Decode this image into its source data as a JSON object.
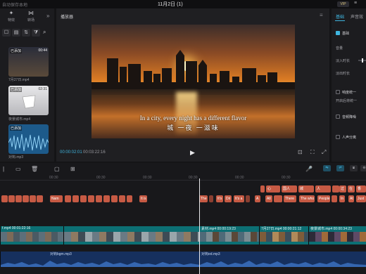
{
  "titlebar": {
    "autosave_hint": "自动保存本地",
    "title": "11月2日 (1)",
    "vip": "VIP",
    "menu": "≡"
  },
  "left_panel": {
    "tabs": [
      {
        "label": "特效",
        "icon": "sparkle-icon"
      },
      {
        "label": "转场",
        "icon": "transition-icon"
      }
    ],
    "more": "»",
    "tools": [
      "☐",
      "▤",
      "⇅",
      "⧩"
    ],
    "search_icon": "⌕",
    "media": [
      {
        "tag": "已添加",
        "duration": "00:44",
        "caption": ""
      },
      {
        "tag": "已添加",
        "duration": "",
        "caption": "7月27日.mp4"
      },
      {
        "tag": "已添加",
        "duration": "02:31",
        "caption": ""
      },
      {
        "tag": "",
        "duration": "",
        "caption": "夜景城市.mp4"
      },
      {
        "tag": "已添加",
        "duration": "",
        "caption": ""
      },
      {
        "tag": "",
        "duration": "",
        "caption": "对钩.mp3"
      }
    ]
  },
  "player": {
    "header": "播放器",
    "menu": "≡",
    "subtitle_en": "In a city, every night has a different flavor",
    "subtitle_zh": "城 一夜 一滋味",
    "current_time": "00:00:02:01",
    "total_time": "00:03:22:16",
    "play_icon": "▶",
    "controls": [
      "⊡",
      "⛶",
      "⤢"
    ]
  },
  "right_panel": {
    "tabs": [
      "基础",
      "声音效"
    ],
    "items": [
      {
        "label": "基础",
        "checked": true
      },
      {
        "label": "音量",
        "checked": null
      },
      {
        "label": "淡入时长",
        "checked": null
      },
      {
        "label": "淡出时长",
        "checked": null
      },
      {
        "label": "响度统一",
        "checked": false
      },
      {
        "label": "开启后将统一",
        "checked": null
      },
      {
        "label": "音频降噪",
        "checked": false
      },
      {
        "label": "人声分离",
        "checked": false
      }
    ],
    "accent": "#3fb6e0"
  },
  "timeline": {
    "tools": [
      "|",
      "▭",
      "🗑",
      "▢",
      "⊞"
    ],
    "right_tools": [
      "🎤",
      "⇆",
      "⇌",
      "⧈",
      "⊖"
    ],
    "ruler": [
      "00:30",
      "00:30",
      "00:30",
      "00:30",
      "00:30",
      "00:30"
    ],
    "text_row1": [
      "",
      "",
      "",
      "",
      "",
      "",
      "",
      "",
      "",
      "",
      "",
      "",
      "",
      "",
      "",
      "",
      "",
      "",
      "",
      "",
      "",
      "",
      "",
      "",
      "",
      "",
      "",
      "",
      "",
      "",
      "",
      "",
      "",
      "",
      "",
      "",
      "",
      "",
      "",
      "",
      "",
      "",
      "",
      "",
      "",
      "",
      "",
      "",
      "",
      "",
      "",
      "",
      "",
      "",
      "",
      "",
      "",
      "",
      "",
      "",
      ""
    ],
    "chips_top": [
      "心",
      "国人",
      "城",
      "今年",
      "人"
    ],
    "chips_row2": [
      "过",
      "在",
      "你",
      "香"
    ],
    "chips_row3": [
      "Nam",
      "It is",
      "The",
      "It's",
      "Dri",
      "It's a",
      "A",
      "All",
      "There",
      "The who",
      "People",
      "In",
      "At",
      "Just"
    ],
    "video_clips": [
      {
        "name": "f.mp4",
        "time": "00:01:22:16"
      },
      {
        "name": "素材.mp4",
        "time": "00:00:19:23"
      },
      {
        "name": "7月27日.mp4",
        "time": "00:00:21:12"
      },
      {
        "name": "夜景城市.mp4",
        "time": "00:00:34:23"
      }
    ],
    "audio_clips": [
      {
        "name": "对钩bgm.mp3"
      },
      {
        "name": "对钩ed.mp3"
      }
    ]
  }
}
